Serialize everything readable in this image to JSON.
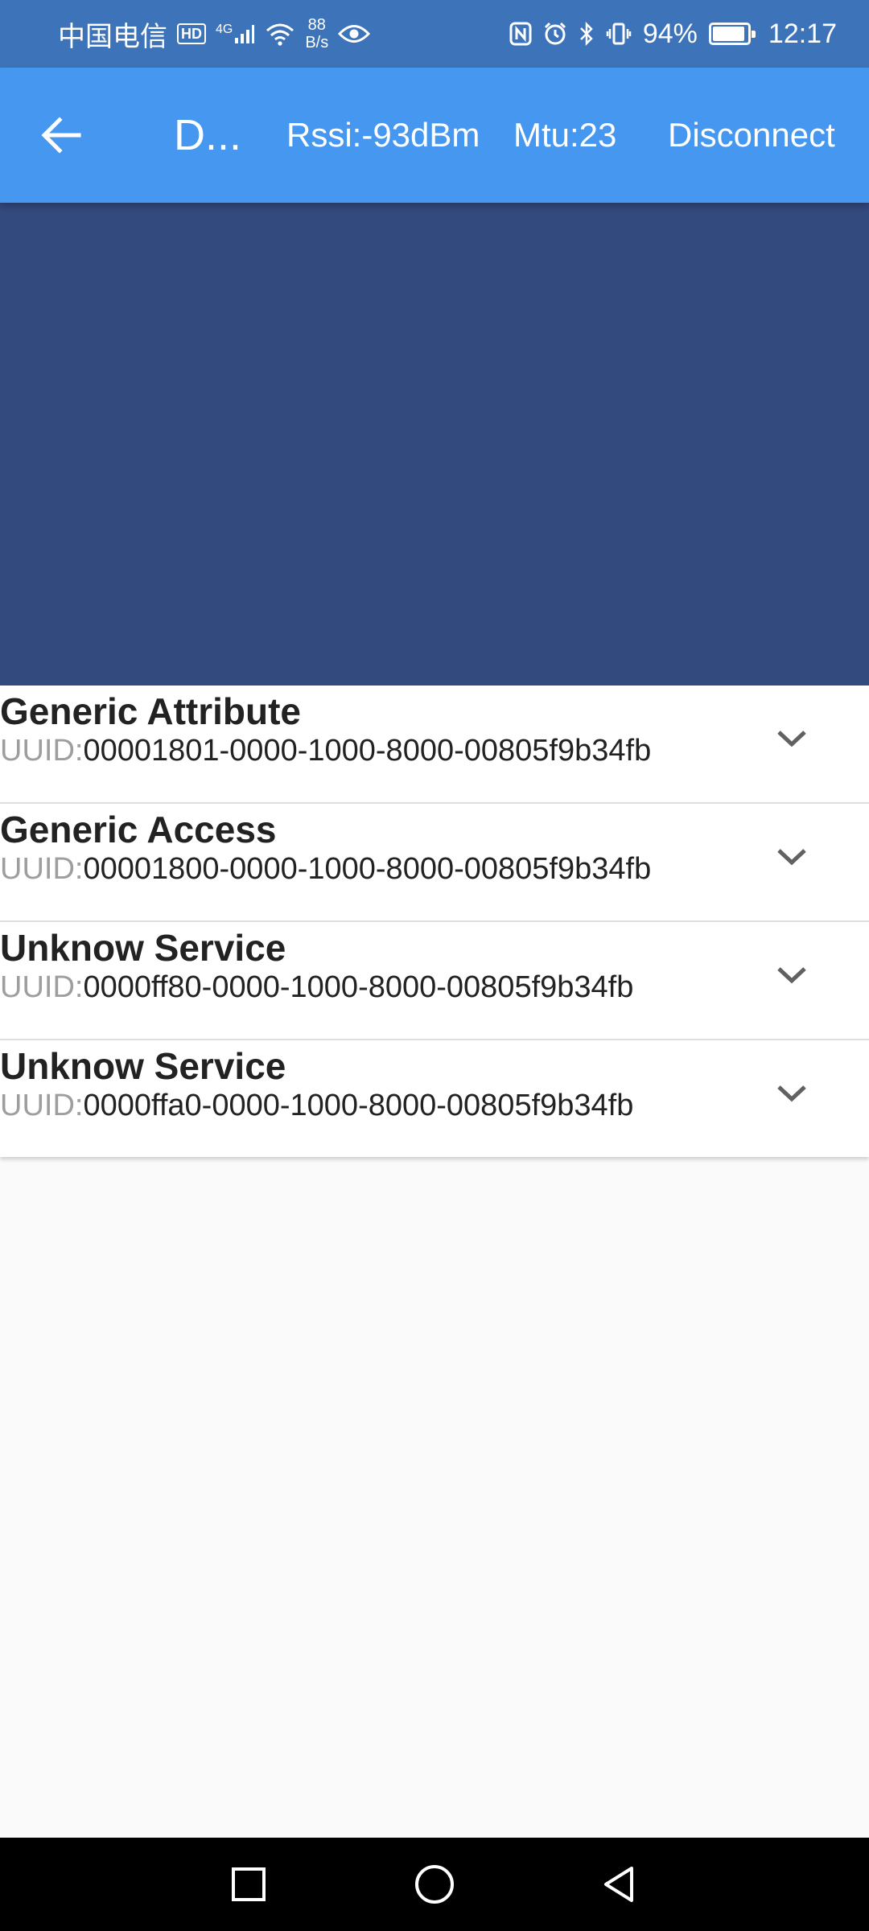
{
  "status_bar": {
    "carrier": "中国电信",
    "hd_badge": "HD",
    "network_type": "4G",
    "net_speed_value": "88",
    "net_speed_unit": "B/s",
    "battery_percent": "94%",
    "time": "12:17",
    "icons": [
      "signal-icon",
      "wifi-icon",
      "eye-icon",
      "nfc-icon",
      "alarm-icon",
      "bluetooth-icon",
      "vibrate-icon",
      "battery-icon"
    ]
  },
  "app_bar": {
    "title": "D...",
    "rssi": "Rssi:-93dBm",
    "mtu": "Mtu:23",
    "disconnect_label": "Disconnect"
  },
  "services": [
    {
      "name": "Generic Attribute",
      "uuid_label": "UUID:",
      "uuid": "00001801-0000-1000-8000-00805f9b34fb"
    },
    {
      "name": "Generic Access",
      "uuid_label": "UUID:",
      "uuid": "00001800-0000-1000-8000-00805f9b34fb"
    },
    {
      "name": "Unknow Service",
      "uuid_label": "UUID:",
      "uuid": "0000ff80-0000-1000-8000-00805f9b34fb"
    },
    {
      "name": "Unknow Service",
      "uuid_label": "UUID:",
      "uuid": "0000ffa0-0000-1000-8000-00805f9b34fb"
    }
  ],
  "colors": {
    "status_bar": "#3d73b8",
    "app_bar": "#4597f0",
    "panel": "#334a7f",
    "background": "#fafafa"
  }
}
